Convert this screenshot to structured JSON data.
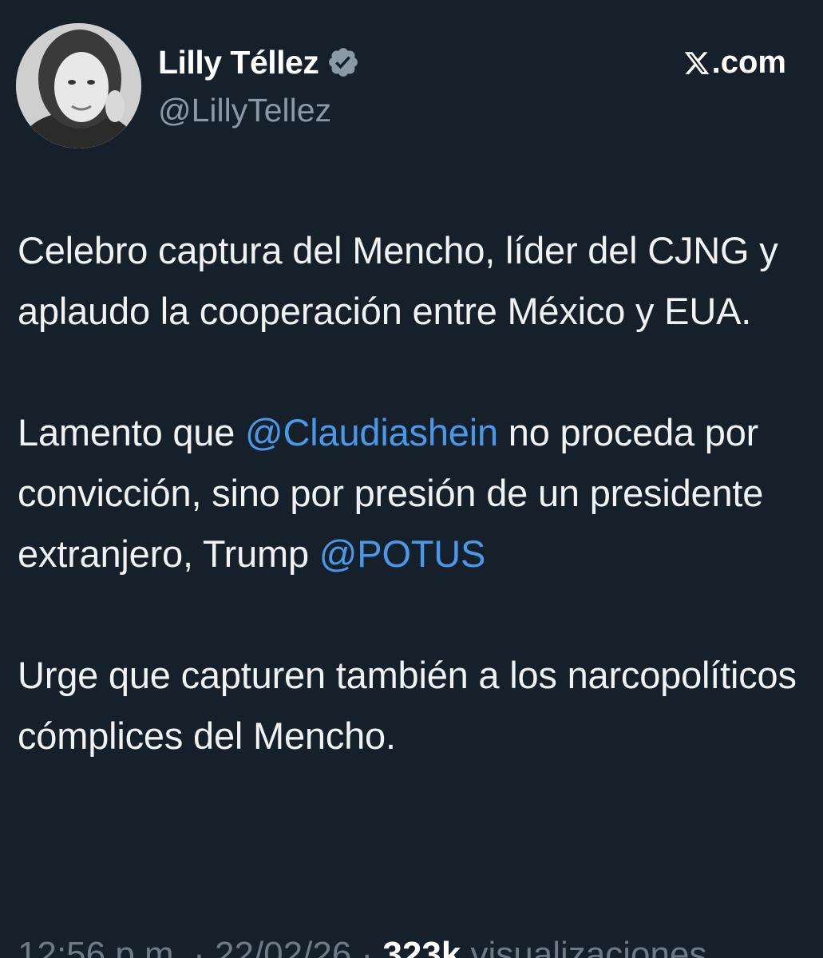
{
  "author": {
    "name": "Lilly Téllez",
    "handle": "@LillyTellez",
    "verified_icon": "verified-badge-icon"
  },
  "site": {
    "label": ".com",
    "logo_icon": "x-logo-icon"
  },
  "tweet": {
    "p1": "Celebro captura del Mencho, líder del CJNG y aplaudo la cooperación entre México y EUA.",
    "p2_before": "Lamento que ",
    "p2_mention1": "@Claudiashein",
    "p2_middle": " no proceda por convicción, sino por presión de un presidente extranjero, Trump ",
    "p2_mention2": "@POTUS",
    "p3": "Urge que capturen también a los narcopolíticos cómplices del Mencho."
  },
  "meta": {
    "time": "12:56 p.m.",
    "sep1": " · ",
    "date": "22/02/26",
    "sep2": " · ",
    "views": "323k",
    "views_label": " visualizaciones"
  },
  "colors": {
    "background": "#15202b",
    "mention": "#4a99e9",
    "secondary_text": "#8b98a5"
  }
}
